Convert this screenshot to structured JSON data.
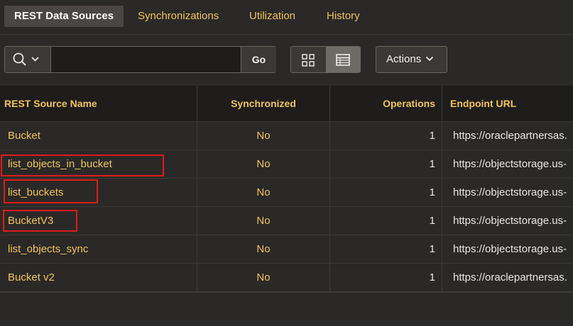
{
  "tabs": [
    {
      "label": "REST Data Sources",
      "active": true
    },
    {
      "label": "Synchronizations",
      "active": false
    },
    {
      "label": "Utilization",
      "active": false
    },
    {
      "label": "History",
      "active": false
    }
  ],
  "toolbar": {
    "search_value": "",
    "go_label": "Go",
    "actions_label": "Actions"
  },
  "table": {
    "columns": [
      "REST Source Name",
      "Synchronized",
      "Operations",
      "Endpoint URL"
    ],
    "rows": [
      {
        "name": "Bucket",
        "synchronized": "No",
        "operations": "1",
        "url": "https://oraclepartnersas.",
        "highlighted": false
      },
      {
        "name": "list_objects_in_bucket",
        "synchronized": "No",
        "operations": "1",
        "url": "https://objectstorage.us-",
        "highlighted": true
      },
      {
        "name": "list_buckets",
        "synchronized": "No",
        "operations": "1",
        "url": "https://objectstorage.us-",
        "highlighted": true
      },
      {
        "name": "BucketV3",
        "synchronized": "No",
        "operations": "1",
        "url": "https://objectstorage.us-",
        "highlighted": true
      },
      {
        "name": "list_objects_sync",
        "synchronized": "No",
        "operations": "1",
        "url": "https://objectstorage.us-",
        "highlighted": false
      },
      {
        "name": "Bucket v2",
        "synchronized": "No",
        "operations": "1",
        "url": "https://oraclepartnersas.",
        "highlighted": false
      }
    ]
  },
  "colors": {
    "link": "#f0c35f",
    "background": "#2b2927",
    "header_bg": "#1f1d1c",
    "highlight_box": "#e01b1b"
  },
  "icons": {
    "search": "search-icon",
    "dropdown": "chevron-down-icon",
    "grid_view": "grid-view-icon",
    "report_view": "report-view-icon"
  }
}
